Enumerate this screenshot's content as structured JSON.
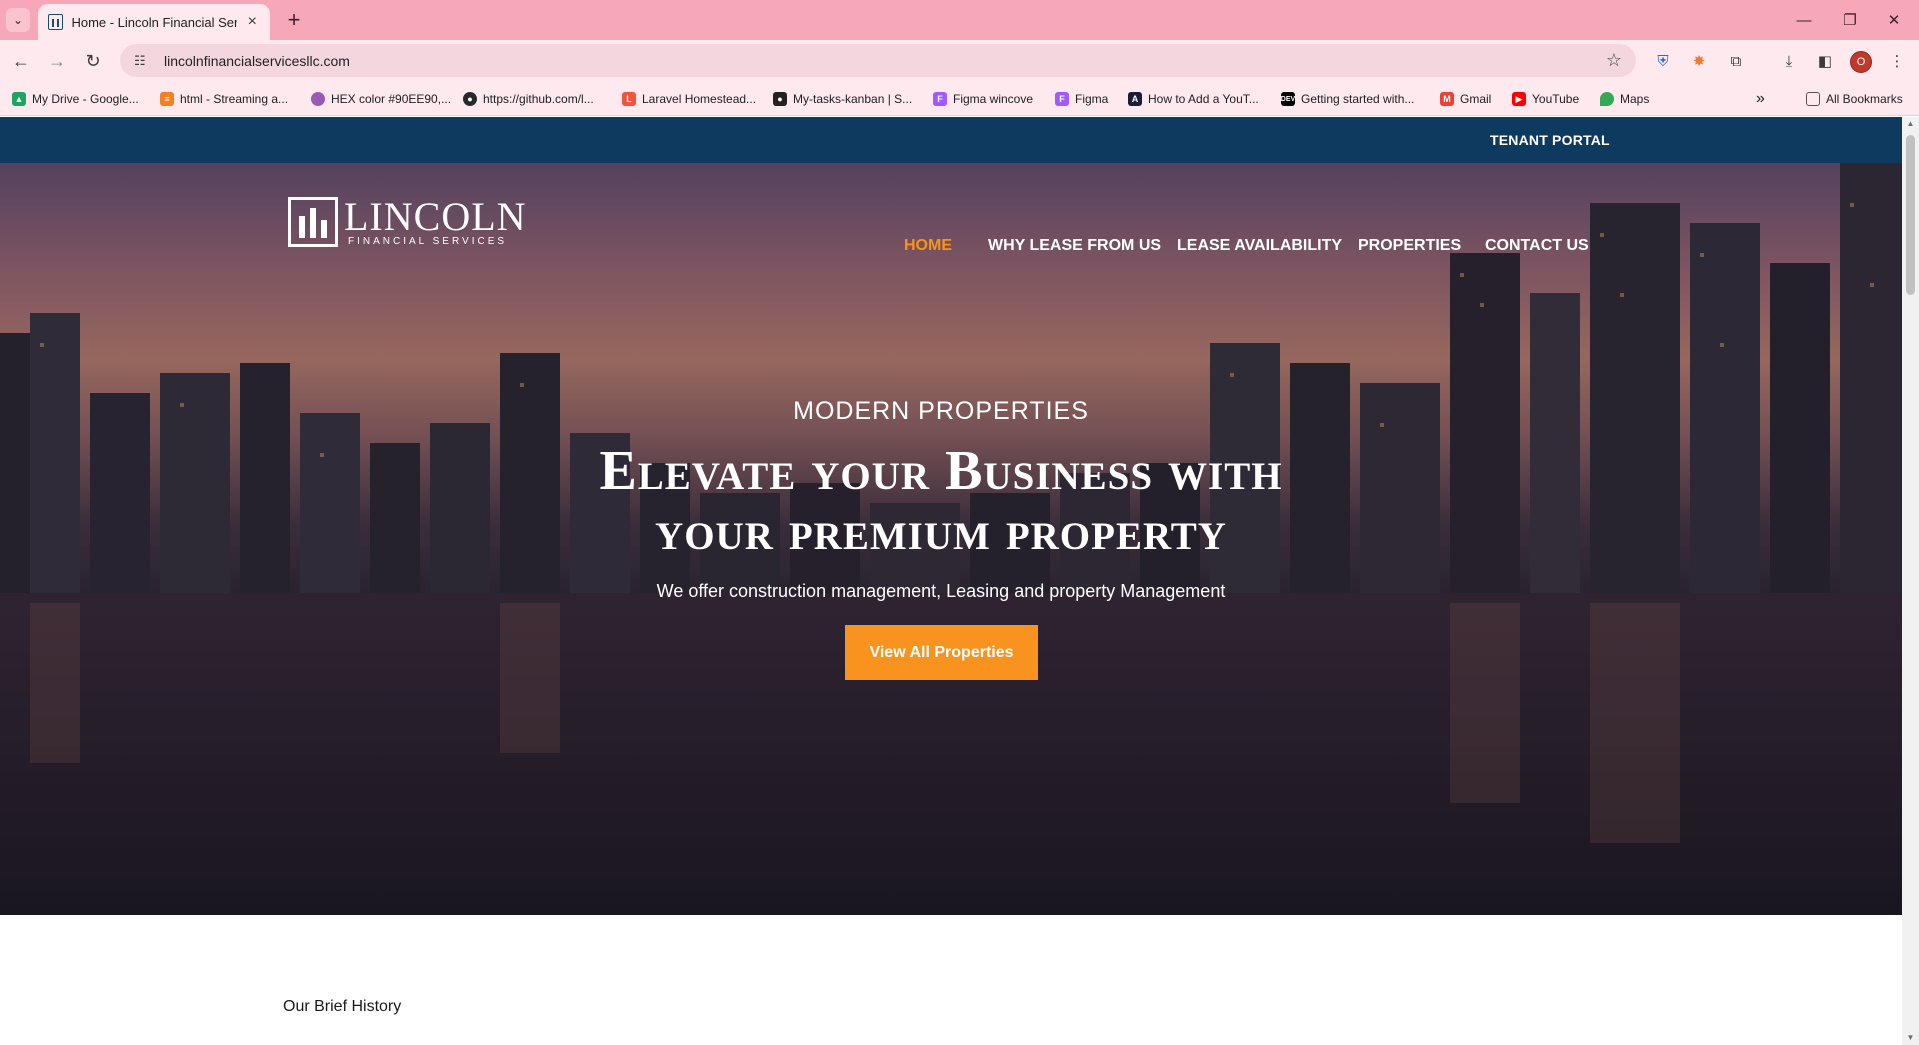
{
  "browser": {
    "tab_title": "Home - Lincoln Financial Servic",
    "url": "lincolnfinancialservicesllc.com",
    "profile_initial": "O",
    "bookmarks": [
      "My Drive - Google...",
      "html - Streaming a...",
      "HEX color #90EE90,...",
      "https://github.com/l...",
      "Laravel Homestead...",
      "My-tasks-kanban | S...",
      "Figma wincove",
      "Figma",
      "How to Add a YouT...",
      "Getting started with...",
      "Gmail",
      "YouTube",
      "Maps"
    ],
    "all_bookmarks": "All Bookmarks",
    "overflow": "»"
  },
  "page": {
    "tenant_portal": "TENANT PORTAL",
    "logo": {
      "name": "LINCOLN",
      "sub": "FINANCIAL SERVICES"
    },
    "nav": [
      "HOME",
      "WHY LEASE FROM US",
      "LEASE AVAILABILITY",
      "PROPERTIES",
      "CONTACT US"
    ],
    "hero": {
      "kicker": "MODERN PROPERTIES",
      "title_line1": "Elevate your Business with",
      "title_line2": "your premium property",
      "subtitle": "We offer construction management, Leasing and property Management",
      "cta": "View All Properties"
    },
    "history_heading": "Our Brief History"
  },
  "colors": {
    "accent": "#f7931e",
    "topbar": "#0f3a5f",
    "tab_strip": "#f7a8b8"
  }
}
